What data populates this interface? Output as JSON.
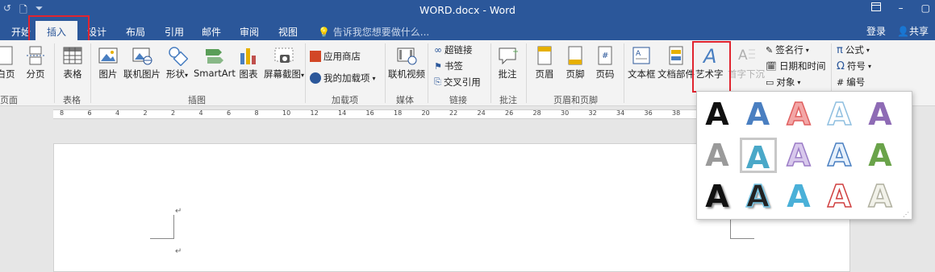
{
  "window": {
    "title": "WORD.docx - Word",
    "restore_icon": "ribbon-display-icon",
    "minimize": "–",
    "maximize": "▢"
  },
  "qat": {
    "redo": "↺",
    "new_doc": "🗋",
    "customize": "⏷"
  },
  "tabs": [
    "开始",
    "插入",
    "设计",
    "布局",
    "引用",
    "邮件",
    "审阅",
    "视图"
  ],
  "active_tab": "插入",
  "tellme": "告诉我您想要做什么...",
  "account": {
    "login": "登录",
    "share": "共享"
  },
  "ribbon": {
    "pages": {
      "blank": "白页",
      "break": "分页",
      "label": "页面"
    },
    "tables": {
      "table": "表格",
      "label": "表格"
    },
    "illustrations": {
      "picture": "图片",
      "online_picture": "联机图片",
      "shapes": "形状",
      "smartart": "SmartArt",
      "chart": "图表",
      "screenshot": "屏幕截图",
      "label": "插图"
    },
    "addins": {
      "store": "应用商店",
      "my_addins": "我的加载项",
      "label": "加载项"
    },
    "media": {
      "online_video": "联机视频",
      "label": "媒体"
    },
    "links": {
      "hyperlink": "超链接",
      "bookmark": "书签",
      "crossref": "交叉引用",
      "label": "链接"
    },
    "comments": {
      "comment": "批注",
      "label": "批注"
    },
    "header_footer": {
      "header": "页眉",
      "footer": "页脚",
      "page_number": "页码",
      "label": "页眉和页脚"
    },
    "text": {
      "textbox": "文本框",
      "quickparts": "文档部件",
      "wordart": "艺术字",
      "dropcap": "首字下沉",
      "signature": "签名行",
      "datetime": "日期和时间",
      "object": "对象"
    },
    "symbols": {
      "equation": "公式",
      "symbol": "符号",
      "number": "编号"
    }
  },
  "ruler_ticks": [
    "8",
    "6",
    "4",
    "2",
    "2",
    "4",
    "6",
    "8",
    "10",
    "12",
    "14",
    "16",
    "18",
    "20",
    "22",
    "24",
    "26",
    "28",
    "30",
    "32",
    "34",
    "36",
    "38"
  ],
  "paragraph_mark": "↵",
  "wordart_gallery": {
    "glyph": "A",
    "styles": [
      {
        "fill": "#111111",
        "stroke": "none"
      },
      {
        "fill": "#4a7fc1",
        "stroke": "none"
      },
      {
        "fill": "#f3a6a6",
        "stroke": "#e06060"
      },
      {
        "fill": "#ffffff",
        "stroke": "#8fbfe0"
      },
      {
        "fill": "#8e6bb5",
        "stroke": "none"
      },
      {
        "fill": "#9a9a9a",
        "stroke": "none"
      },
      {
        "fill": "#4aa8c8",
        "stroke": "none"
      },
      {
        "fill": "#d8c8ec",
        "stroke": "#9b7cc6"
      },
      {
        "fill": "#e6f0fb",
        "stroke": "#4a7fc1"
      },
      {
        "fill": "#6aa34a",
        "stroke": "none"
      },
      {
        "fill": "#111111",
        "stroke": "none"
      },
      {
        "fill": "#222222",
        "stroke": "#7ac7e6"
      },
      {
        "fill": "#4ab0d8",
        "stroke": "none"
      },
      {
        "fill": "#ffffff",
        "stroke": "#d04040"
      },
      {
        "fill": "#f2f2ea",
        "stroke": "#b0b0a0"
      }
    ]
  },
  "colors": {
    "brand": "#2b579a",
    "highlight": "#e0242f"
  }
}
